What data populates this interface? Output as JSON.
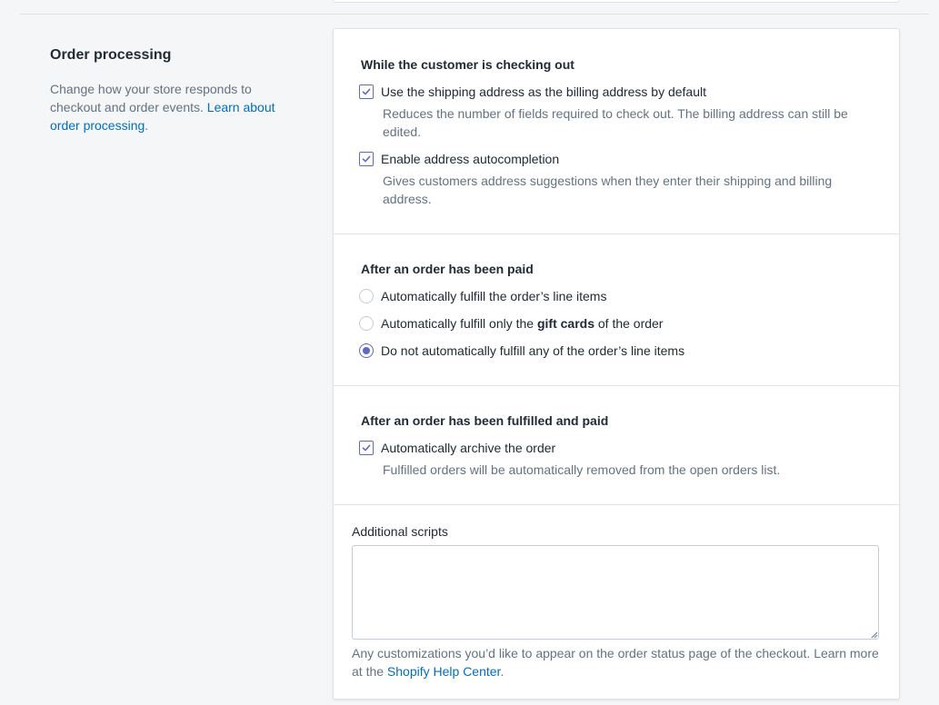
{
  "annotation": {
    "title": "Order processing",
    "description": "Change how your store responds to checkout and order events. ",
    "link": "Learn about order processing",
    "period": "."
  },
  "checkout_section": {
    "title": "While the customer is checking out",
    "options": [
      {
        "label": "Use the shipping address as the billing address by default",
        "checked": true,
        "help": "Reduces the number of fields required to check out. The billing address can still be edited."
      },
      {
        "label": "Enable address autocompletion",
        "checked": true,
        "help": "Gives customers address suggestions when they enter their shipping and billing address."
      }
    ]
  },
  "paid_section": {
    "title": "After an order has been paid",
    "options": [
      {
        "label": "Automatically fulfill the order’s line items",
        "selected": false
      },
      {
        "label_before": "Automatically fulfill only the ",
        "label_bold": "gift cards",
        "label_after": " of the order",
        "selected": false
      },
      {
        "label": "Do not automatically fulfill any of the order’s line items",
        "selected": true
      }
    ]
  },
  "fulfilled_section": {
    "title": "After an order has been fulfilled and paid",
    "options": [
      {
        "label": "Automatically archive the order",
        "checked": true,
        "help": "Fulfilled orders will be automatically removed from the open orders list."
      }
    ]
  },
  "scripts_section": {
    "label": "Additional scripts",
    "value": "",
    "help_text": "Any customizations you’d like to appear on the order status page of the checkout. Learn more at the ",
    "help_link": "Shopify Help Center",
    "help_end": "."
  },
  "colors": {
    "accent": "#5c6ac4",
    "link": "#006fbb",
    "muted_text": "#637381",
    "background": "#f4f6f8"
  }
}
